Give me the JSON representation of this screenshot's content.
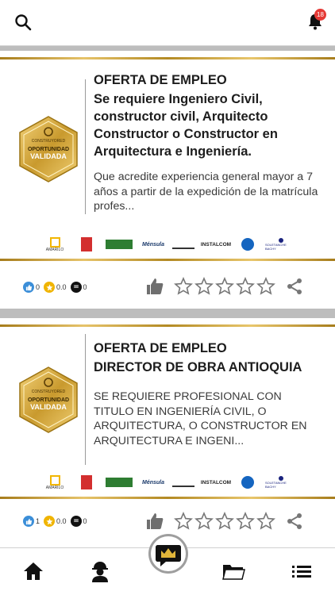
{
  "header": {
    "search_icon": "search-icon",
    "bell_icon": "bell-icon",
    "notification_count": "18"
  },
  "badge": {
    "top": "CONSTRUYORED",
    "line1": "OPORTUNIDAD",
    "line2": "VALIDADA"
  },
  "cards": [
    {
      "heading": "OFERTA DE EMPLEO",
      "title": "Se requiere Ingeniero Civil, constructor civil, Arquitecto Constructor o Constructor en Arquitectura e Ingeniería.",
      "description": "Que acredite experiencia general mayor a 7 años a partir de la expedición de la matrícula profes...",
      "stats": {
        "likes": "0",
        "rating": "0.0",
        "comments": "0"
      }
    },
    {
      "heading": "OFERTA DE EMPLEO",
      "title": "DIRECTOR DE OBRA ANTIOQUIA",
      "description": "SE REQUIERE PROFESIONAL CON TITULO EN INGENIERÍA CIVIL, O ARQUITECTURA, O CONSTRUCTOR EN ARQUITECTURA E INGENI...",
      "stats": {
        "likes": "1",
        "rating": "0.0",
        "comments": "0"
      }
    }
  ],
  "sponsors": [
    "AMARILO",
    "",
    "",
    "Ménsula",
    "",
    "INSTALCOM",
    "",
    "SOLETANCHE BACHY"
  ],
  "colors": {
    "gold": "#c9a038",
    "accent_blue": "#3b8ed8",
    "star_yellow": "#f0b400",
    "icon_grey": "#777777"
  },
  "bottom_nav": [
    "home-icon",
    "worker-icon",
    "crown-chat-icon",
    "folder-icon",
    "list-icon"
  ]
}
